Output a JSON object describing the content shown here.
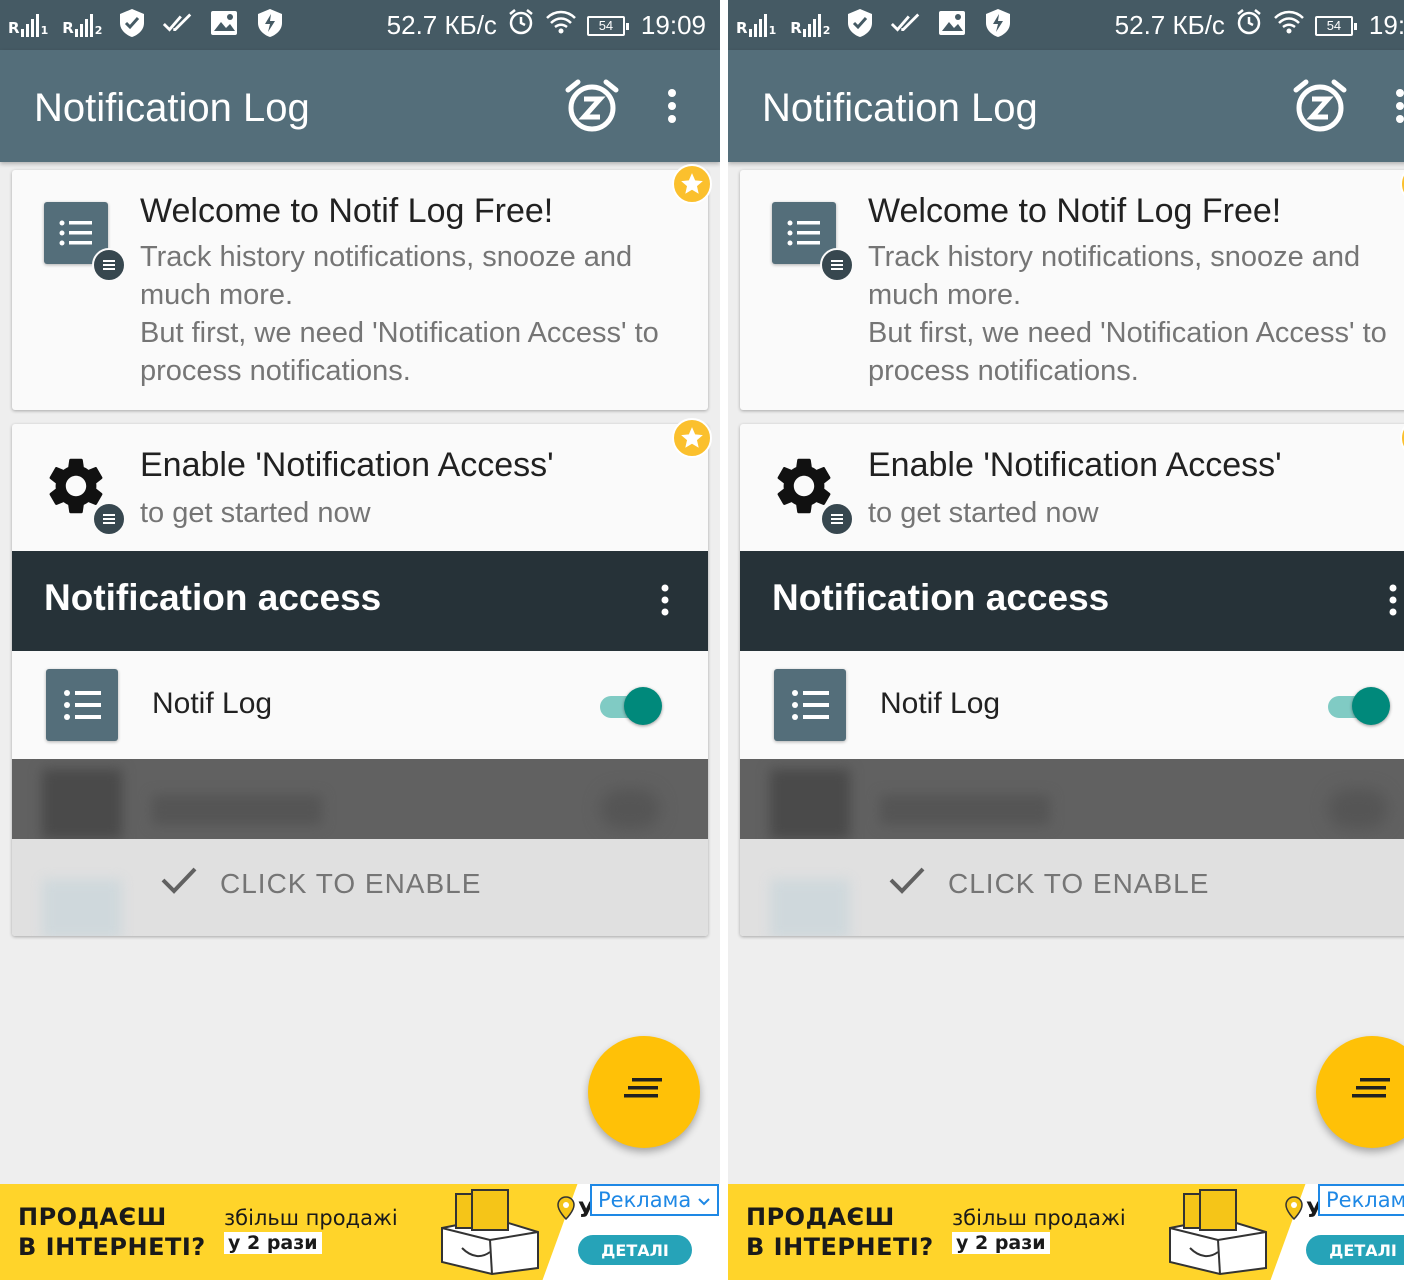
{
  "status_bar": {
    "sim1": "R",
    "sim1_index": "1",
    "sim2": "R",
    "sim2_index": "2",
    "speed": "52.7 КБ/с",
    "battery": "54",
    "time": "19:09",
    "icons": [
      "shield-check-icon",
      "double-check-icon",
      "image-icon",
      "bolt-shield-icon",
      "alarm-icon",
      "wifi-icon",
      "battery-icon"
    ]
  },
  "app_bar": {
    "title": "Notification Log",
    "icons": [
      "snooze-alarm-icon",
      "more-vert-icon"
    ]
  },
  "welcome_card": {
    "title": "Welcome to Notif Log Free!",
    "text": "Track history notifications, snooze and much more.\nBut first, we need 'Notification Access' to process notifications.",
    "icon": "list-icon",
    "badge": "star-icon"
  },
  "enable_card": {
    "title": "Enable 'Notification Access'",
    "subtitle": "to get started now",
    "icon": "gear-icon",
    "badge": "star-icon",
    "preview": {
      "header": "Notification access",
      "app_label": "Notif Log",
      "toggle_on": true
    },
    "action_label": "CLICK TO ENABLE"
  },
  "fab": {
    "icon": "sort-icon"
  },
  "ad": {
    "headline_line1": "ПРОДАЄШ",
    "headline_line2": "В ІНТЕРНЕТІ?",
    "sub_line1": "збільш продажі",
    "sub_line2": "у 2 рази",
    "label": "Реклама",
    "partial_text": "У",
    "button": "ДЕТАЛІ"
  },
  "colors": {
    "status_bar": "#455a64",
    "app_bar": "#546e7a",
    "dark_header": "#263238",
    "accent_teal": "#00897b",
    "fab_yellow": "#ffc107",
    "star_yellow": "#fbc02d",
    "ad_yellow": "#ffd42a"
  }
}
